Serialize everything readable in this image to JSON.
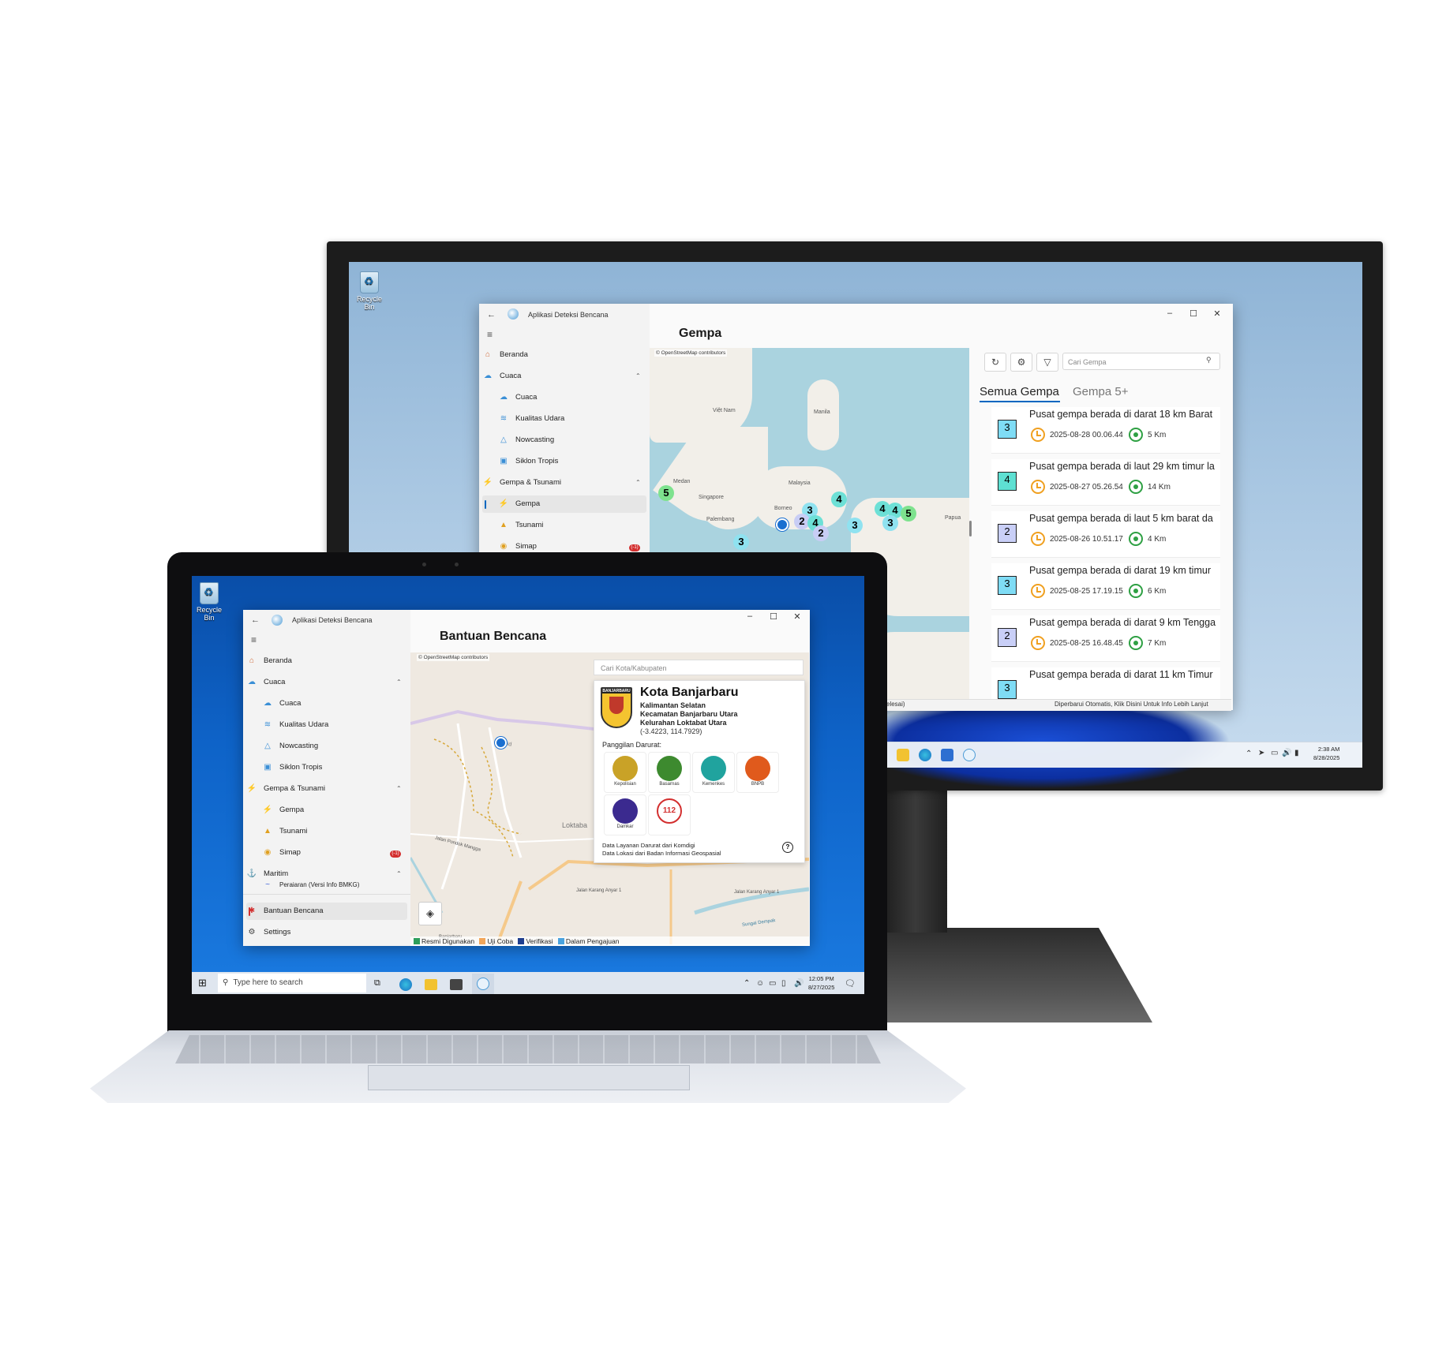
{
  "desktop": {
    "recycle_bin": "Recycle Bin",
    "search_placeholder": "Type here to search"
  },
  "monitor": {
    "clock_time": "2:38 AM",
    "clock_date": "8/28/2025",
    "app": {
      "title": "Aplikasi Deteksi Bencana",
      "page_title": "Gempa",
      "nav": {
        "beranda": "Beranda",
        "cuaca_group": "Cuaca",
        "cuaca": "Cuaca",
        "kualitas_udara": "Kualitas Udara",
        "nowcasting": "Nowcasting",
        "siklon_tropis": "Siklon Tropis",
        "gempa_group": "Gempa & Tsunami",
        "gempa": "Gempa",
        "tsunami": "Tsunami",
        "simap": "Simap",
        "simap_badge": "(-1)"
      },
      "map_attribution": "© OpenStreetMap contributors",
      "map_labels": {
        "viet_nam": "Việt Nam",
        "malaysia": "Malaysia",
        "singapore": "Singapore",
        "borneo": "Borneo",
        "palembang": "Palembang",
        "manila": "Manila",
        "medan": "Medan",
        "papua": "Papua"
      },
      "clusters": [
        "5",
        "3",
        "2",
        "4",
        "2",
        "4",
        "3",
        "4",
        "4",
        "3",
        "5",
        "3"
      ],
      "search_placeholder": "Cari Gempa",
      "tabs": [
        "Semua Gempa",
        "Gempa 5+"
      ],
      "earthquakes": [
        {
          "mag": "3",
          "color": "#7fdcf5",
          "title": "Pusat gempa berada di darat 18 km Barat",
          "time": "2025-08-28 00.06.44",
          "depth": "5 Km"
        },
        {
          "mag": "4",
          "color": "#5ee0d2",
          "title": "Pusat gempa berada di laut 29 km timur la",
          "time": "2025-08-27 05.26.54",
          "depth": "14 Km"
        },
        {
          "mag": "2",
          "color": "#c9cff7",
          "title": "Pusat gempa berada di laut 5 km barat da",
          "time": "2025-08-26 10.51.17",
          "depth": "4 Km"
        },
        {
          "mag": "3",
          "color": "#7fdcf5",
          "title": "Pusat gempa berada di darat 19 km timur",
          "time": "2025-08-25 17.19.15",
          "depth": "6 Km"
        },
        {
          "mag": "2",
          "color": "#c9cff7",
          "title": "Pusat gempa berada di darat 9 km Tengga",
          "time": "2025-08-25 16.48.45",
          "depth": "7 Km"
        },
        {
          "mag": "3",
          "color": "#7fdcf5",
          "title": "Pusat gempa berada di darat 11 km Timur",
          "time": "",
          "depth": ""
        }
      ],
      "status_left": "elesai)",
      "status_right": "Diperbarui Otomatis, Klik Disini Untuk Info Lebih Lanjut"
    }
  },
  "laptop": {
    "clock_time": "12:05 PM",
    "clock_date": "8/27/2025",
    "app": {
      "title": "Aplikasi Deteksi Bencana",
      "page_title": "Bantuan Bencana",
      "nav": {
        "beranda": "Beranda",
        "cuaca_group": "Cuaca",
        "cuaca": "Cuaca",
        "kualitas_udara": "Kualitas Udara",
        "nowcasting": "Nowcasting",
        "siklon_tropis": "Siklon Tropis",
        "gempa_group": "Gempa & Tsunami",
        "gempa": "Gempa",
        "tsunami": "Tsunami",
        "simap": "Simap",
        "simap_badge": "(-1)",
        "maritim": "Maritim",
        "maritim_sub": "Peraiaran (Versi Info BMKG)",
        "bantuan": "Bantuan Bencana",
        "settings": "Settings"
      },
      "map_attribution": "© OpenStreetMap contributors",
      "search_placeholder": "Cari Kota/Kabupaten",
      "city": {
        "logo_text": "BANJARBARU",
        "name": "Kota Banjarbaru",
        "province": "Kalimantan Selatan",
        "district": "Kecamatan Banjarbaru Utara",
        "village": "Kelurahan Loktabat Utara",
        "coords": "(-3.4223, 114.7929)"
      },
      "emergency_label": "Panggilan Darurat:",
      "agencies": [
        {
          "name": "Kepolisian",
          "color": "#c9a227"
        },
        {
          "name": "Basarnas",
          "color": "#3d8a2f"
        },
        {
          "name": "Kemenkes",
          "color": "#20a39e"
        },
        {
          "name": "BNPB",
          "color": "#e05a1c"
        },
        {
          "name": "Damkar",
          "color": "#3b2a8f"
        },
        {
          "name": "112",
          "color": "#d32f2f"
        }
      ],
      "source_1": "Data Layanan Darurat dari Komdigi",
      "source_2": "Data Lokasi dari Badan Informasi Geospasial",
      "help_icon": "?",
      "road_labels": {
        "loktabat": "Loktaba",
        "jalan_karang_anyar_1": "Jalan Karang Anyar 1",
        "jalan_karang_anyar_1b": "Jalan Karang Anyar 1",
        "jalan_pondok_mangga": "Jalan Pondok Mangga",
        "sungai_dempak": "Sungai Dempak",
        "banjarbaru_label": "Banjarbaru",
        "mesjid": "Mesjid"
      },
      "legend": [
        {
          "label": "Resmi Digunakan",
          "color": "#2e9e5b"
        },
        {
          "label": "Uji Coba",
          "color": "#f2a65a"
        },
        {
          "label": "Verifikasi",
          "color": "#1f3f8f"
        },
        {
          "label": "Dalam Pengajuan",
          "color": "#4aa3df"
        }
      ]
    }
  }
}
